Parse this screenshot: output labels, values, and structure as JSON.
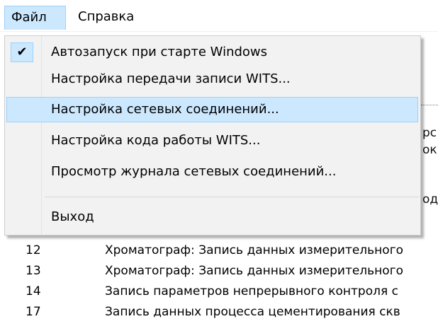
{
  "menubar": {
    "file_label": "Файл",
    "help_label": "Справка"
  },
  "file_menu": {
    "items": [
      {
        "label": "Автозапуск при старте Windows",
        "checked": true
      },
      {
        "label": "Настройка передачи записи WITS..."
      },
      {
        "label": "Настройка сетевых соединений...",
        "highlighted": true
      },
      {
        "label": "Настройка кода работы WITS..."
      },
      {
        "label": "Просмотр журнала сетевых соединений..."
      },
      {
        "label": "Выход"
      }
    ],
    "check_glyph": "✔"
  },
  "background": {
    "edge_fragments": [
      "рс",
      "ок",
      "од"
    ],
    "rows": [
      {
        "code": "12",
        "description": "Хроматограф: Запись данных измерительного"
      },
      {
        "code": "13",
        "description": "Хроматограф: Запись данных измерительного"
      },
      {
        "code": "14",
        "description": "Запись параметров непрерывного контроля с"
      },
      {
        "code": "17",
        "description": "Запись данных процесса цементирования скв"
      }
    ]
  },
  "colors": {
    "highlight_fill": "#cce8ff",
    "highlight_border": "#99d1ff",
    "menu_background": "#f2f2f2"
  }
}
